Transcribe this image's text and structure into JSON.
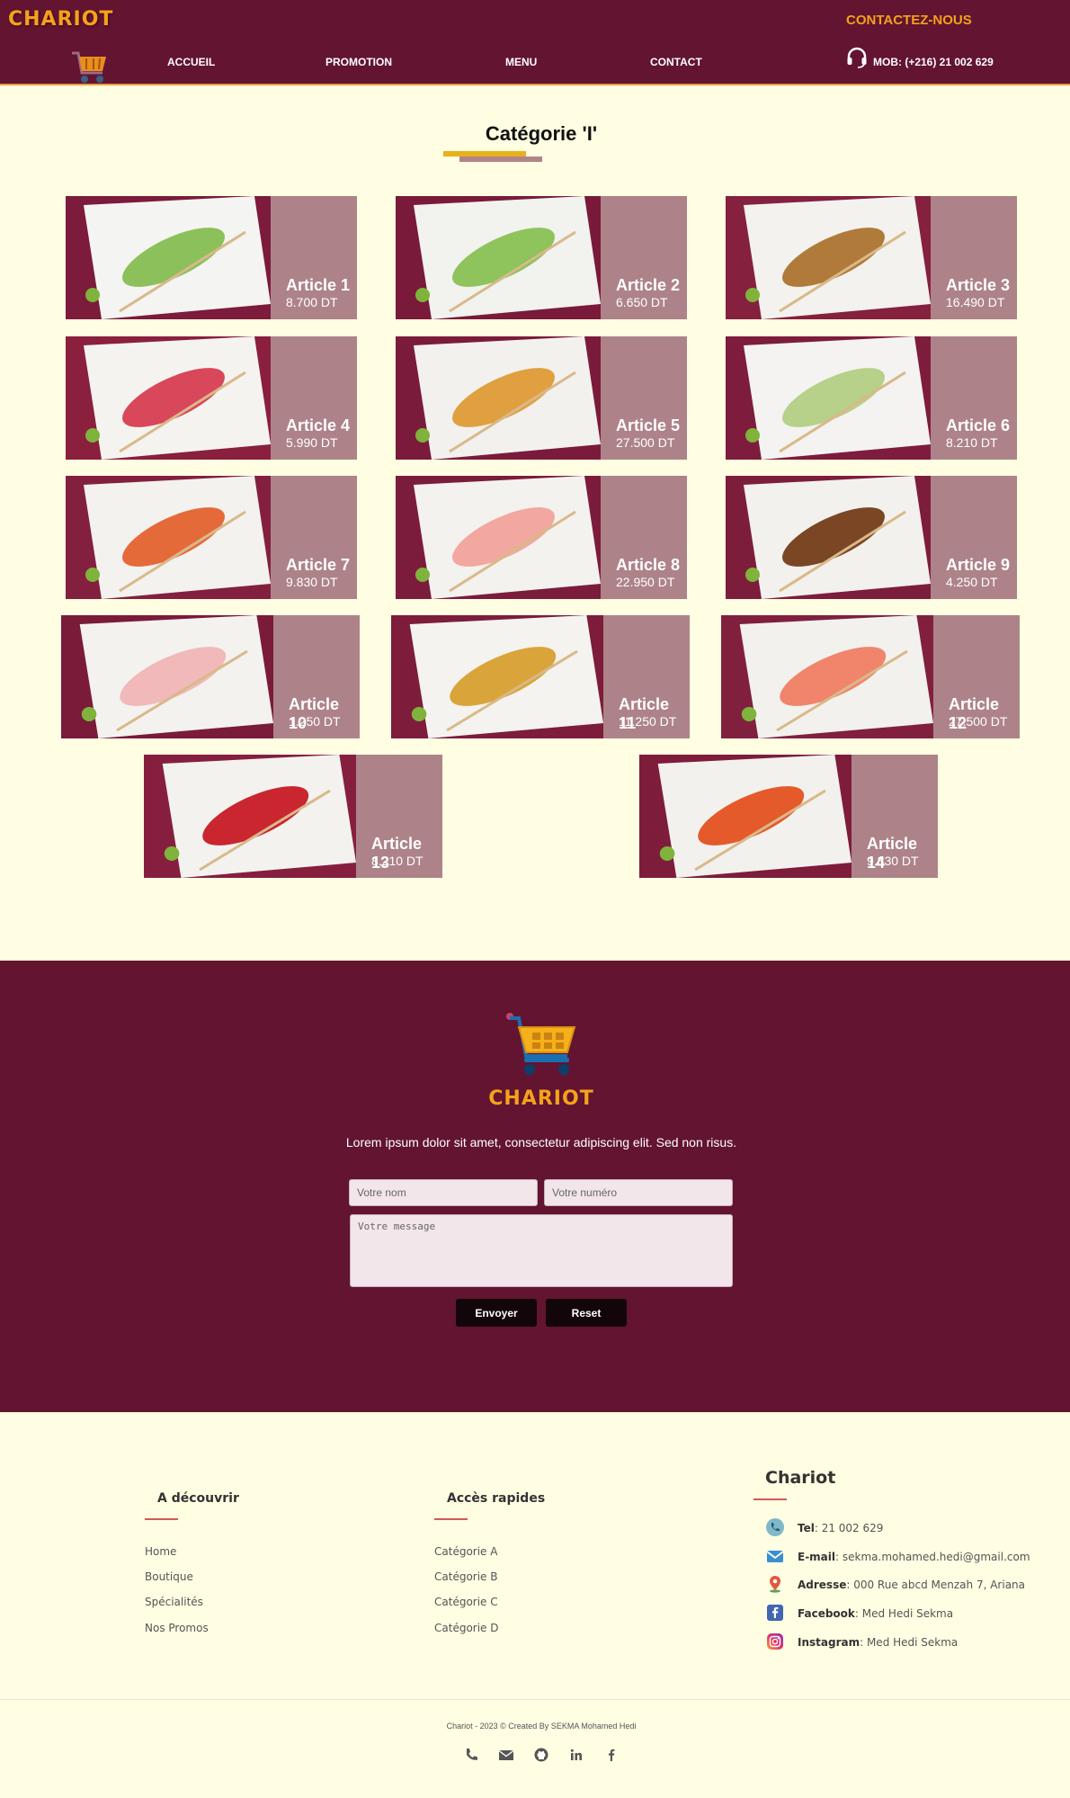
{
  "header": {
    "brand": "CHARIOT",
    "nav": [
      "ACCUEIL",
      "PROMOTION",
      "MENU",
      "CONTACT"
    ],
    "contact_title": "CONTACTEZ-NOUS",
    "phone": "MOB: (+216) 21 002 629"
  },
  "category": {
    "title": "Catégorie 'I'",
    "articles": [
      {
        "name": "Article 1",
        "price": "8.700 DT"
      },
      {
        "name": "Article 2",
        "price": "6.650 DT"
      },
      {
        "name": "Article 3",
        "price": "16.490 DT"
      },
      {
        "name": "Article 4",
        "price": "5.990 DT"
      },
      {
        "name": "Article 5",
        "price": "27.500 DT"
      },
      {
        "name": "Article 6",
        "price": "8.210 DT"
      },
      {
        "name": "Article 7",
        "price": "9.830 DT"
      },
      {
        "name": "Article 8",
        "price": "22.950 DT"
      },
      {
        "name": "Article 9",
        "price": "4.250 DT"
      },
      {
        "name": "Article 10",
        "price": "1.250 DT"
      },
      {
        "name": "Article 11",
        "price": "11.250 DT"
      },
      {
        "name": "Article 12",
        "price": "27.500 DT"
      },
      {
        "name": "Article 13",
        "price": "8.210 DT"
      },
      {
        "name": "Article 14",
        "price": "9.830 DT"
      }
    ]
  },
  "contact_form": {
    "brand": "CHARIOT",
    "text": "Lorem ipsum dolor sit amet, consectetur adipiscing elit. Sed non risus.",
    "name_placeholder": "Votre nom",
    "number_placeholder": "Votre numéro",
    "message_placeholder": "Votre message",
    "submit_label": "Envoyer",
    "reset_label": "Reset"
  },
  "footer": {
    "discover": {
      "title": "A découvrir",
      "links": [
        "Home",
        "Boutique",
        "Spécialités",
        "Nos Promos"
      ]
    },
    "quick": {
      "title": "Accès rapides",
      "links": [
        "Catégorie A",
        "Catégorie B",
        "Catégorie C",
        "Catégorie D"
      ]
    },
    "company": {
      "title": "Chariot",
      "rows": [
        {
          "label": "Tel",
          "value": ": 21 002 629",
          "icon": "phone-icon"
        },
        {
          "label": "E-mail",
          "value": ": sekma.mohamed.hedi@gmail.com",
          "icon": "mail-icon"
        },
        {
          "label": "Adresse",
          "value": ": 000 Rue abcd Menzah 7, Ariana",
          "icon": "location-icon"
        },
        {
          "label": "Facebook",
          "value": ": Med Hedi Sekma",
          "icon": "facebook-icon"
        },
        {
          "label": "Instagram",
          "value": ": Med Hedi Sekma",
          "icon": "instagram-icon"
        }
      ]
    },
    "credits": "Chariot - 2023 © Created By SEKMA Mohamed Hedi",
    "social_icons": [
      "phone-icon",
      "mail-icon",
      "github-icon",
      "linkedin-icon",
      "facebook-icon"
    ]
  },
  "colors": {
    "primary": "#621431",
    "accent": "#f5a21b",
    "card": "#ad8389",
    "background": "#fffde2"
  }
}
